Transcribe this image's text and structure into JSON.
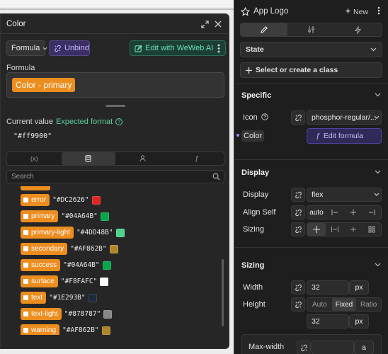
{
  "colors": {
    "accent_orange": "#ec8d1f",
    "purple": "#b5a3ff",
    "teal": "#6ee0b6"
  },
  "modal": {
    "title": "Color",
    "icons": {
      "expand": "expand-icon",
      "close": "close-icon"
    },
    "formula_dropdown_label": "Formula",
    "unbind_label": "Unbind",
    "weweb_ai_label": "Edit with WeWeb AI",
    "formula_section_label": "Formula",
    "formula_chip_label": "Color - primary",
    "current_value_label": "Current value",
    "expected_format_label": "Expected format",
    "current_value": "\"#ff9900\"",
    "tabs": [
      {
        "icon": "variables-icon",
        "glyph": "(x)"
      },
      {
        "icon": "database-icon",
        "glyph": ""
      },
      {
        "icon": "user-icon",
        "glyph": ""
      },
      {
        "icon": "function-icon",
        "glyph": "ƒ"
      }
    ],
    "search_placeholder": "Search",
    "color_items": [
      {
        "name": "error",
        "hex": "\"#DC2626\"",
        "swatch": "#DC2626"
      },
      {
        "name": "primary",
        "hex": "\"#04A64B\"",
        "swatch": "#04A64B"
      },
      {
        "name": "primary-light",
        "hex": "\"#4DD48B\"",
        "swatch": "#4DD48B"
      },
      {
        "name": "secondary",
        "hex": "\"#AF862B\"",
        "swatch": "#AF862B"
      },
      {
        "name": "success",
        "hex": "\"#04A64B\"",
        "swatch": "#04A64B"
      },
      {
        "name": "surface",
        "hex": "\"#F8FAFC\"",
        "swatch": "#F8FAFC"
      },
      {
        "name": "text",
        "hex": "\"#1E293B\"",
        "swatch": "#1E293B"
      },
      {
        "name": "text-light",
        "hex": "\"#878787\"",
        "swatch": "#878787"
      },
      {
        "name": "warning",
        "hex": "\"#AF862B\"",
        "swatch": "#AF862B"
      }
    ]
  },
  "panel": {
    "element_title": "App Logo",
    "new_label": "New",
    "state_label": "State",
    "class_label": "Select or create a class",
    "sections": {
      "specific": {
        "title": "Specific",
        "icon_label": "Icon",
        "icon_value": "phosphor-regular/...",
        "color_label": "Color",
        "color_value": "Edit formula"
      },
      "display": {
        "title": "Display",
        "display_label": "Display",
        "display_value": "flex",
        "align_self_label": "Align Self",
        "align_self_value": "auto",
        "sizing_label": "Sizing"
      },
      "sizing": {
        "title": "Sizing",
        "width_label": "Width",
        "width_value": "32",
        "width_unit": "px",
        "height_label": "Height",
        "height_modes": [
          "Auto",
          "Fixed",
          "Ratio"
        ],
        "height_active_mode": "Fixed",
        "height_value": "32",
        "height_unit": "px",
        "max_width_label": "Max-width",
        "max_width_unit": "a"
      }
    }
  }
}
